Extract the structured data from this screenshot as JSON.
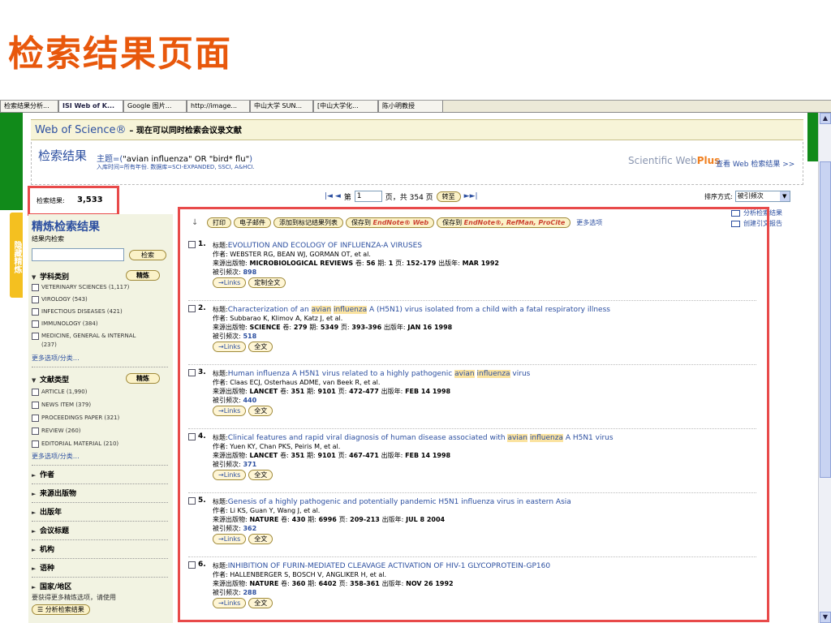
{
  "slide_title": "检索结果页面",
  "taskbar": [
    {
      "label": "检索结果分析..."
    },
    {
      "label": "ISI Web of K..."
    },
    {
      "label": "Google 图片..."
    },
    {
      "label": "http://image..."
    },
    {
      "label": "中山大学 SUN..."
    },
    {
      "label": "[中山大学化..."
    },
    {
      "label": "陈小明教授"
    }
  ],
  "header": {
    "brand": "Web of Science®",
    "tagline": "– 现在可以同时检索会议录文献"
  },
  "results_header": {
    "title": "检索结果",
    "query_prefix": "主题=(",
    "query_text": "\"avian influenza\" OR \"bird* flu\"",
    "query_suffix": ")",
    "meta": "入库时间=所有年份. 数据库=SCI-EXPANDED, SSCI, A&HCI.",
    "webplus_prefix": "Scientific Web",
    "webplus_plus": "Plus",
    "webplus_link": "查看 Web 检索结果 >>"
  },
  "count": {
    "label": "检索结果:",
    "value": "3,533"
  },
  "pager": {
    "first_prev": "|◄ ◄",
    "page_label": "第",
    "page_value": "1",
    "total": "页，共 354 页",
    "go": "转至",
    "next_last": "►►|"
  },
  "sort": {
    "label": "排序方式:",
    "value": "被引频次"
  },
  "vertical_tab": "隐藏精炼",
  "sidebar": {
    "title": "精炼检索结果",
    "sub": "结果内检索",
    "search_btn": "检索",
    "refine_btn": "精炼",
    "subject_title": "学科类别",
    "subjects": [
      "VETERINARY SCIENCES (1,117)",
      "VIROLOGY (543)",
      "INFECTIOUS DISEASES (421)",
      "IMMUNOLOGY (384)",
      "MEDICINE, GENERAL & INTERNAL",
      "(237)"
    ],
    "more1": "更多选项/分类…",
    "doctype_title": "文献类型",
    "doctypes": [
      "ARTICLE (1,990)",
      "NEWS ITEM (379)",
      "PROCEEDINGS PAPER (321)",
      "REVIEW (260)",
      "EDITORIAL MATERIAL (210)"
    ],
    "more2": "更多选项/分类…",
    "collapsed": [
      "作者",
      "来源出版物",
      "出版年",
      "会议标题",
      "机构",
      "语种",
      "国家/地区"
    ],
    "note": "要获得更多精炼选项，请使用",
    "analyze_btn": "分析检索结果"
  },
  "toolbar": {
    "print": "打印",
    "email": "电子邮件",
    "add_marked": "添加到标记结果列表",
    "save_to": "保存到",
    "endnote_web": "EndNote® Web",
    "save_to2": "保存到",
    "endnote_ref": "EndNote®, RefMan, ProCite",
    "more": "更多选项"
  },
  "side_links": {
    "analyze": "分析检索结果",
    "citation_report": "创建引文报告"
  },
  "labels": {
    "title": "标题:",
    "author": "作者:",
    "source": "来源出版物:",
    "vol": "卷:",
    "issue": "期:",
    "pages": "页:",
    "date": "出版年:",
    "cited": "被引频次:",
    "links": "Links",
    "fulltext": "全文",
    "custom_fulltext": "定制全文"
  },
  "records": [
    {
      "num": "1.",
      "title_parts": [
        "EVOLUTION AND ECOLOGY OF INFLUENZA-A VIRUSES"
      ],
      "authors": "WEBSTER RG, BEAN WJ, GORMAN OT, et al.",
      "source": "MICROBIOLOGICAL REVIEWS",
      "vol": "56",
      "issue": "1",
      "pages": "152-179",
      "date": "MAR 1992",
      "cited": "898",
      "btn2": "定制全文"
    },
    {
      "num": "2.",
      "title_parts": [
        "Characterization of an ",
        "avian",
        " ",
        "influenza",
        " A (H5N1) virus isolated from a child with a fatal respiratory illness"
      ],
      "authors": "Subbarao K, Klimov A, Katz J, et al.",
      "source": "SCIENCE",
      "vol": "279",
      "issue": "5349",
      "pages": "393-396",
      "date": "JAN 16 1998",
      "cited": "518",
      "btn2": "全文"
    },
    {
      "num": "3.",
      "title_parts": [
        "Human influenza A H5N1 virus related to a highly pathogenic ",
        "avian",
        " ",
        "influenza",
        " virus"
      ],
      "authors": "Claas ECJ, Osterhaus ADME, van Beek R, et al.",
      "source": "LANCET",
      "vol": "351",
      "issue": "9101",
      "pages": "472-477",
      "date": "FEB 14 1998",
      "cited": "440",
      "btn2": "全文"
    },
    {
      "num": "4.",
      "title_parts": [
        "Clinical features and rapid viral diagnosis of human disease associated with ",
        "avian",
        " ",
        "influenza",
        " A H5N1 virus"
      ],
      "authors": "Yuen KY, Chan PKS, Peiris M, et al.",
      "source": "LANCET",
      "vol": "351",
      "issue": "9101",
      "pages": "467-471",
      "date": "FEB 14 1998",
      "cited": "371",
      "btn2": "全文"
    },
    {
      "num": "5.",
      "title_parts": [
        "Genesis of a highly pathogenic and potentially pandemic H5N1 influenza virus in eastern Asia"
      ],
      "authors": "Li KS, Guan Y, Wang J, et al.",
      "source": "NATURE",
      "vol": "430",
      "issue": "6996",
      "pages": "209-213",
      "date": "JUL 8 2004",
      "cited": "362",
      "btn2": "全文"
    },
    {
      "num": "6.",
      "title_parts": [
        "INHIBITION OF FURIN-MEDIATED CLEAVAGE ACTIVATION OF HIV-1 GLYCOPROTEIN-GP160"
      ],
      "authors": "HALLENBERGER S, BOSCH V, ANGLIKER H, et al.",
      "source": "NATURE",
      "vol": "360",
      "issue": "6402",
      "pages": "358-361",
      "date": "NOV 26 1992",
      "cited": "288",
      "btn2": "全文"
    }
  ],
  "colors": {
    "accent": "#2c4fa0",
    "title_orange": "#e8580c",
    "highlight_box": "#e84a4a",
    "green": "#118a1a"
  }
}
